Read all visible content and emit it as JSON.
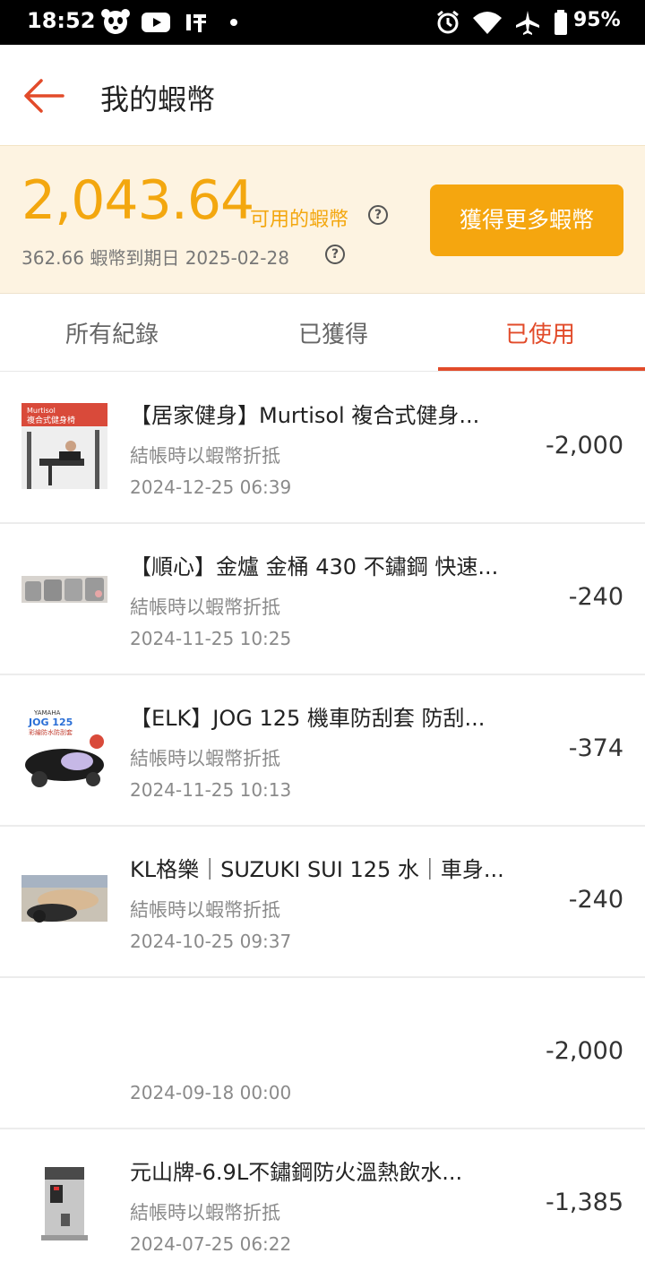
{
  "status_bar": {
    "time": "18:52",
    "battery": "95%",
    "icons": [
      "panda-app-icon",
      "youtube-icon",
      "taobao-icon",
      "dot-icon",
      "alarm-icon",
      "wifi-icon",
      "airplane-icon",
      "battery-icon"
    ]
  },
  "header": {
    "title": "我的蝦幣",
    "back_icon": "arrow-left-icon"
  },
  "coins": {
    "amount": "2,043.64",
    "available_label": "可用的蝦幣",
    "expiry": "362.66 蝦幣到期日 2025-02-28",
    "earn_button": "獲得更多蝦幣",
    "accent_color": "#f5a60f"
  },
  "tabs": [
    {
      "label": "所有紀錄",
      "active": false
    },
    {
      "label": "已獲得",
      "active": false
    },
    {
      "label": "已使用",
      "active": true
    }
  ],
  "transactions": [
    {
      "title": "【居家健身】Murtisol 複合式健身...",
      "desc": "結帳時以蝦幣折抵",
      "date": "2024-12-25 06:39",
      "amount": "-2,000"
    },
    {
      "title": "【順心】金爐 金桶 430 不鏽鋼 快速...",
      "desc": "結帳時以蝦幣折抵",
      "date": "2024-11-25 10:25",
      "amount": "-240"
    },
    {
      "title": "【ELK】JOG 125 機車防刮套 防刮...",
      "desc": "結帳時以蝦幣折抵",
      "date": "2024-11-25 10:13",
      "amount": "-374"
    },
    {
      "title": "KL格樂｜SUZUKI SUI 125 水｜車身...",
      "desc": "結帳時以蝦幣折抵",
      "date": "2024-10-25 09:37",
      "amount": "-240"
    },
    {
      "title": "",
      "desc": "",
      "date": "2024-09-18 00:00",
      "amount": "-2,000"
    },
    {
      "title": "元山牌-6.9L不鏽鋼防火溫熱飲水...",
      "desc": "結帳時以蝦幣折抵",
      "date": "2024-07-25 06:22",
      "amount": "-1,385"
    }
  ],
  "thumb_labels": {
    "gym_brand": "Murtisol",
    "gym_sub": "複合式健身椅",
    "moto_brand": "YAMAHA",
    "moto_model": "JOG 125",
    "moto_sub": "彩繪防水防刮套"
  },
  "colors": {
    "accent_red": "#e24b2a",
    "coin_orange": "#f3a70f",
    "panel_bg": "#fdf3e1"
  }
}
